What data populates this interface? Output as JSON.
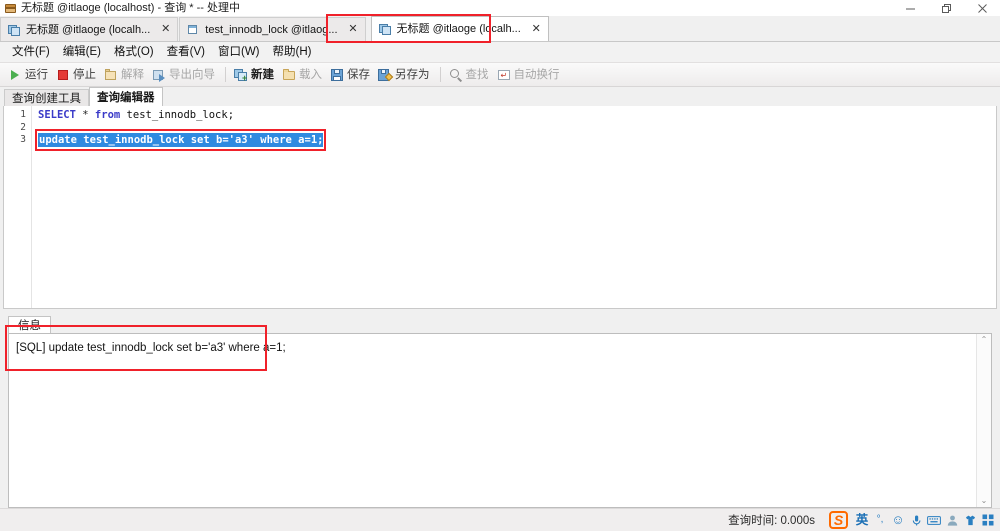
{
  "window": {
    "title": "无标题 @itlaoge (localhost) - 查询 * -- 处理中",
    "icon": "navicat-query-icon",
    "controls": {
      "minimize": "−",
      "restore": "❐",
      "close": "✕"
    }
  },
  "document_tabs": [
    {
      "label": "无标题 @itlaoge (localh...",
      "icon": "query-tab-icon",
      "close": "✕",
      "active": false
    },
    {
      "label": "test_innodb_lock @itlaog...",
      "icon": "table-tab-icon",
      "close": "✕",
      "active": false
    },
    {
      "label": "无标题 @itlaoge (localh...",
      "icon": "query-tab-icon",
      "close": "✕",
      "active": true
    }
  ],
  "menu": {
    "items": [
      {
        "label": "文件(F)"
      },
      {
        "label": "编辑(E)"
      },
      {
        "label": "格式(O)"
      },
      {
        "label": "查看(V)"
      },
      {
        "label": "窗口(W)"
      },
      {
        "label": "帮助(H)"
      }
    ]
  },
  "toolbar": {
    "buttons": [
      {
        "label": "运行",
        "icon": "run-icon",
        "disabled": false
      },
      {
        "label": "停止",
        "icon": "stop-icon",
        "disabled": false
      },
      {
        "label": "解释",
        "icon": "explain-icon",
        "disabled": true
      },
      {
        "label": "导出向导",
        "icon": "export-icon",
        "disabled": true
      },
      {
        "label": "新建",
        "icon": "new-icon",
        "disabled": false
      },
      {
        "label": "载入",
        "icon": "load-icon",
        "disabled": true
      },
      {
        "label": "保存",
        "icon": "save-icon",
        "disabled": false
      },
      {
        "label": "另存为",
        "icon": "save-as-icon",
        "disabled": false
      },
      {
        "label": "查找",
        "icon": "find-icon",
        "disabled": true
      },
      {
        "label": "自动换行",
        "icon": "word-wrap-icon",
        "disabled": true
      }
    ]
  },
  "sub_tabs": [
    {
      "label": "查询创建工具",
      "active": false
    },
    {
      "label": "查询编辑器",
      "active": true
    }
  ],
  "editor": {
    "line_numbers": [
      "1",
      "2",
      "3"
    ],
    "lines": [
      {
        "number": "1",
        "keyword1": "SELECT",
        "star": "*",
        "keyword2": "from",
        "rest": "test_innodb_lock;",
        "selected": false
      },
      {
        "number": "2",
        "text": "",
        "selected": false
      },
      {
        "number": "3",
        "text": "update test_innodb_lock set b='a3' where a=1;",
        "selected": true
      }
    ],
    "selection_color": "#2f8ae0",
    "keyword_color": "#3a3ac8"
  },
  "info_panel": {
    "tab_label": "信息",
    "lines": [
      "[SQL] update test_innodb_lock set b='a3' where a=1;"
    ],
    "scroll_up": "⌃",
    "scroll_down": "⌄"
  },
  "status_bar": {
    "query_time": "查询时间: 0.000s",
    "ime": {
      "logo": "S",
      "items": [
        {
          "name": "input-mode-english",
          "glyph": "英"
        },
        {
          "name": "punctuation-toggle",
          "glyph": "°,"
        },
        {
          "name": "emoji-icon",
          "glyph": "☺"
        },
        {
          "name": "voice-input-icon",
          "glyph": "mic"
        },
        {
          "name": "soft-keyboard-icon",
          "glyph": "keyboard"
        },
        {
          "name": "user-center-icon",
          "glyph": "user"
        },
        {
          "name": "skin-icon",
          "glyph": "shirt"
        },
        {
          "name": "toolbox-icon",
          "glyph": "grid"
        }
      ]
    }
  },
  "annotations": {
    "accent_color": "#f0212a",
    "boxes": [
      {
        "name": "active-tab-highlight"
      },
      {
        "name": "selected-sql-highlight"
      },
      {
        "name": "info-output-highlight"
      }
    ]
  }
}
